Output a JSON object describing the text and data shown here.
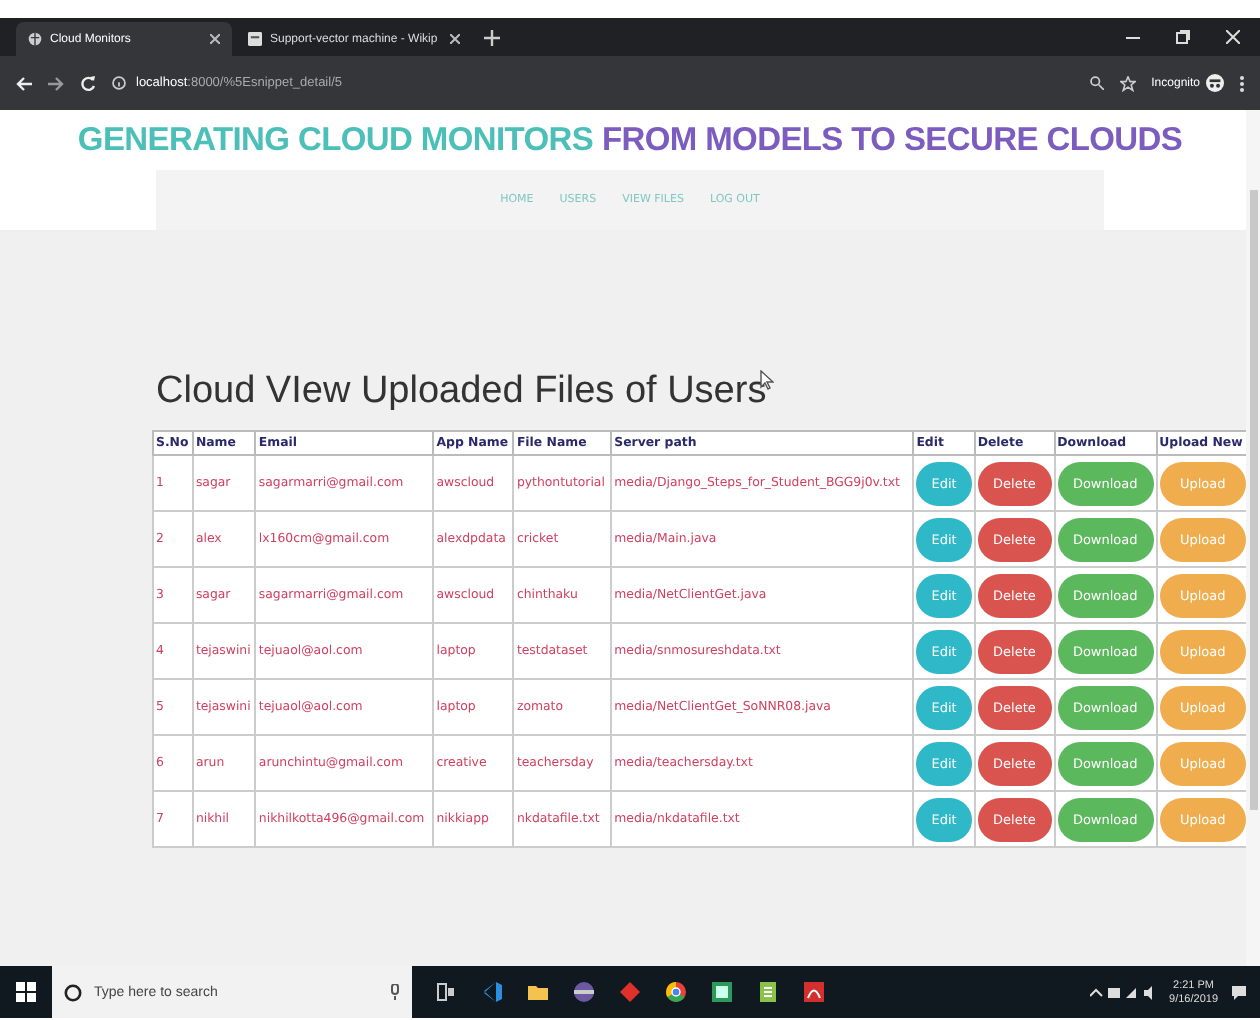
{
  "browser": {
    "tabs": [
      {
        "label": "Cloud Monitors",
        "selected": true
      },
      {
        "label": "Support-vector machine - Wikip",
        "selected": false
      }
    ],
    "address": {
      "host": "localhost",
      "path": ":8000/%5Esnippet_detail/5"
    },
    "profile": "Incognito"
  },
  "header": {
    "title_part_1": "GENERATING CLOUD MONITORS",
    "title_part_2": "FROM MODELS TO SECURE CLOUDS",
    "nav": [
      "HOME",
      "USERS",
      "VIEW FILES",
      "LOG OUT"
    ]
  },
  "page_title": "Cloud VIew Uploaded Files of Users",
  "table": {
    "columns": [
      "S.No",
      "Name",
      "Email",
      "App Name",
      "File Name",
      "Server path",
      "Edit",
      "Delete",
      "Download",
      "Upload New"
    ],
    "rows": [
      {
        "cells": [
          "1",
          "sagar",
          "sagarmarri@gmail.com",
          "awscloud",
          "pythontutorial",
          "media/Django_Steps_for_Student_BGG9j0v.txt"
        ],
        "actions": [
          "Edit",
          "Delete",
          "Download",
          "Upload"
        ]
      },
      {
        "cells": [
          "2",
          "alex",
          "lx160cm@gmail.com",
          "alexdpdata",
          "cricket",
          "media/Main.java"
        ],
        "actions": [
          "Edit",
          "Delete",
          "Download",
          "Upload"
        ]
      },
      {
        "cells": [
          "3",
          "sagar",
          "sagarmarri@gmail.com",
          "awscloud",
          "chinthaku",
          "media/NetClientGet.java"
        ],
        "actions": [
          "Edit",
          "Delete",
          "Download",
          "Upload"
        ]
      },
      {
        "cells": [
          "4",
          "tejaswini",
          "tejuaol@aol.com",
          "laptop",
          "testdataset",
          "media/snmosureshdata.txt"
        ],
        "actions": [
          "Edit",
          "Delete",
          "Download",
          "Upload"
        ]
      },
      {
        "cells": [
          "5",
          "tejaswini",
          "tejuaol@aol.com",
          "laptop",
          "zomato",
          "media/NetClientGet_SoNNR08.java"
        ],
        "actions": [
          "Edit",
          "Delete",
          "Download",
          "Upload"
        ]
      },
      {
        "cells": [
          "6",
          "arun",
          "arunchintu@gmail.com",
          "creative",
          "teachersday",
          "media/teachersday.txt"
        ],
        "actions": [
          "Edit",
          "Delete",
          "Download",
          "Upload"
        ]
      },
      {
        "cells": [
          "7",
          "nikhil",
          "nikhilkotta496@gmail.com",
          "nikkiapp",
          "nkdatafile.txt",
          "media/nkdatafile.txt"
        ],
        "actions": [
          "Edit",
          "Delete",
          "Download",
          "Upload"
        ]
      }
    ]
  },
  "taskbar": {
    "search_placeholder": "Type here to search",
    "time": "2:21 PM",
    "date": "9/16/2019"
  }
}
